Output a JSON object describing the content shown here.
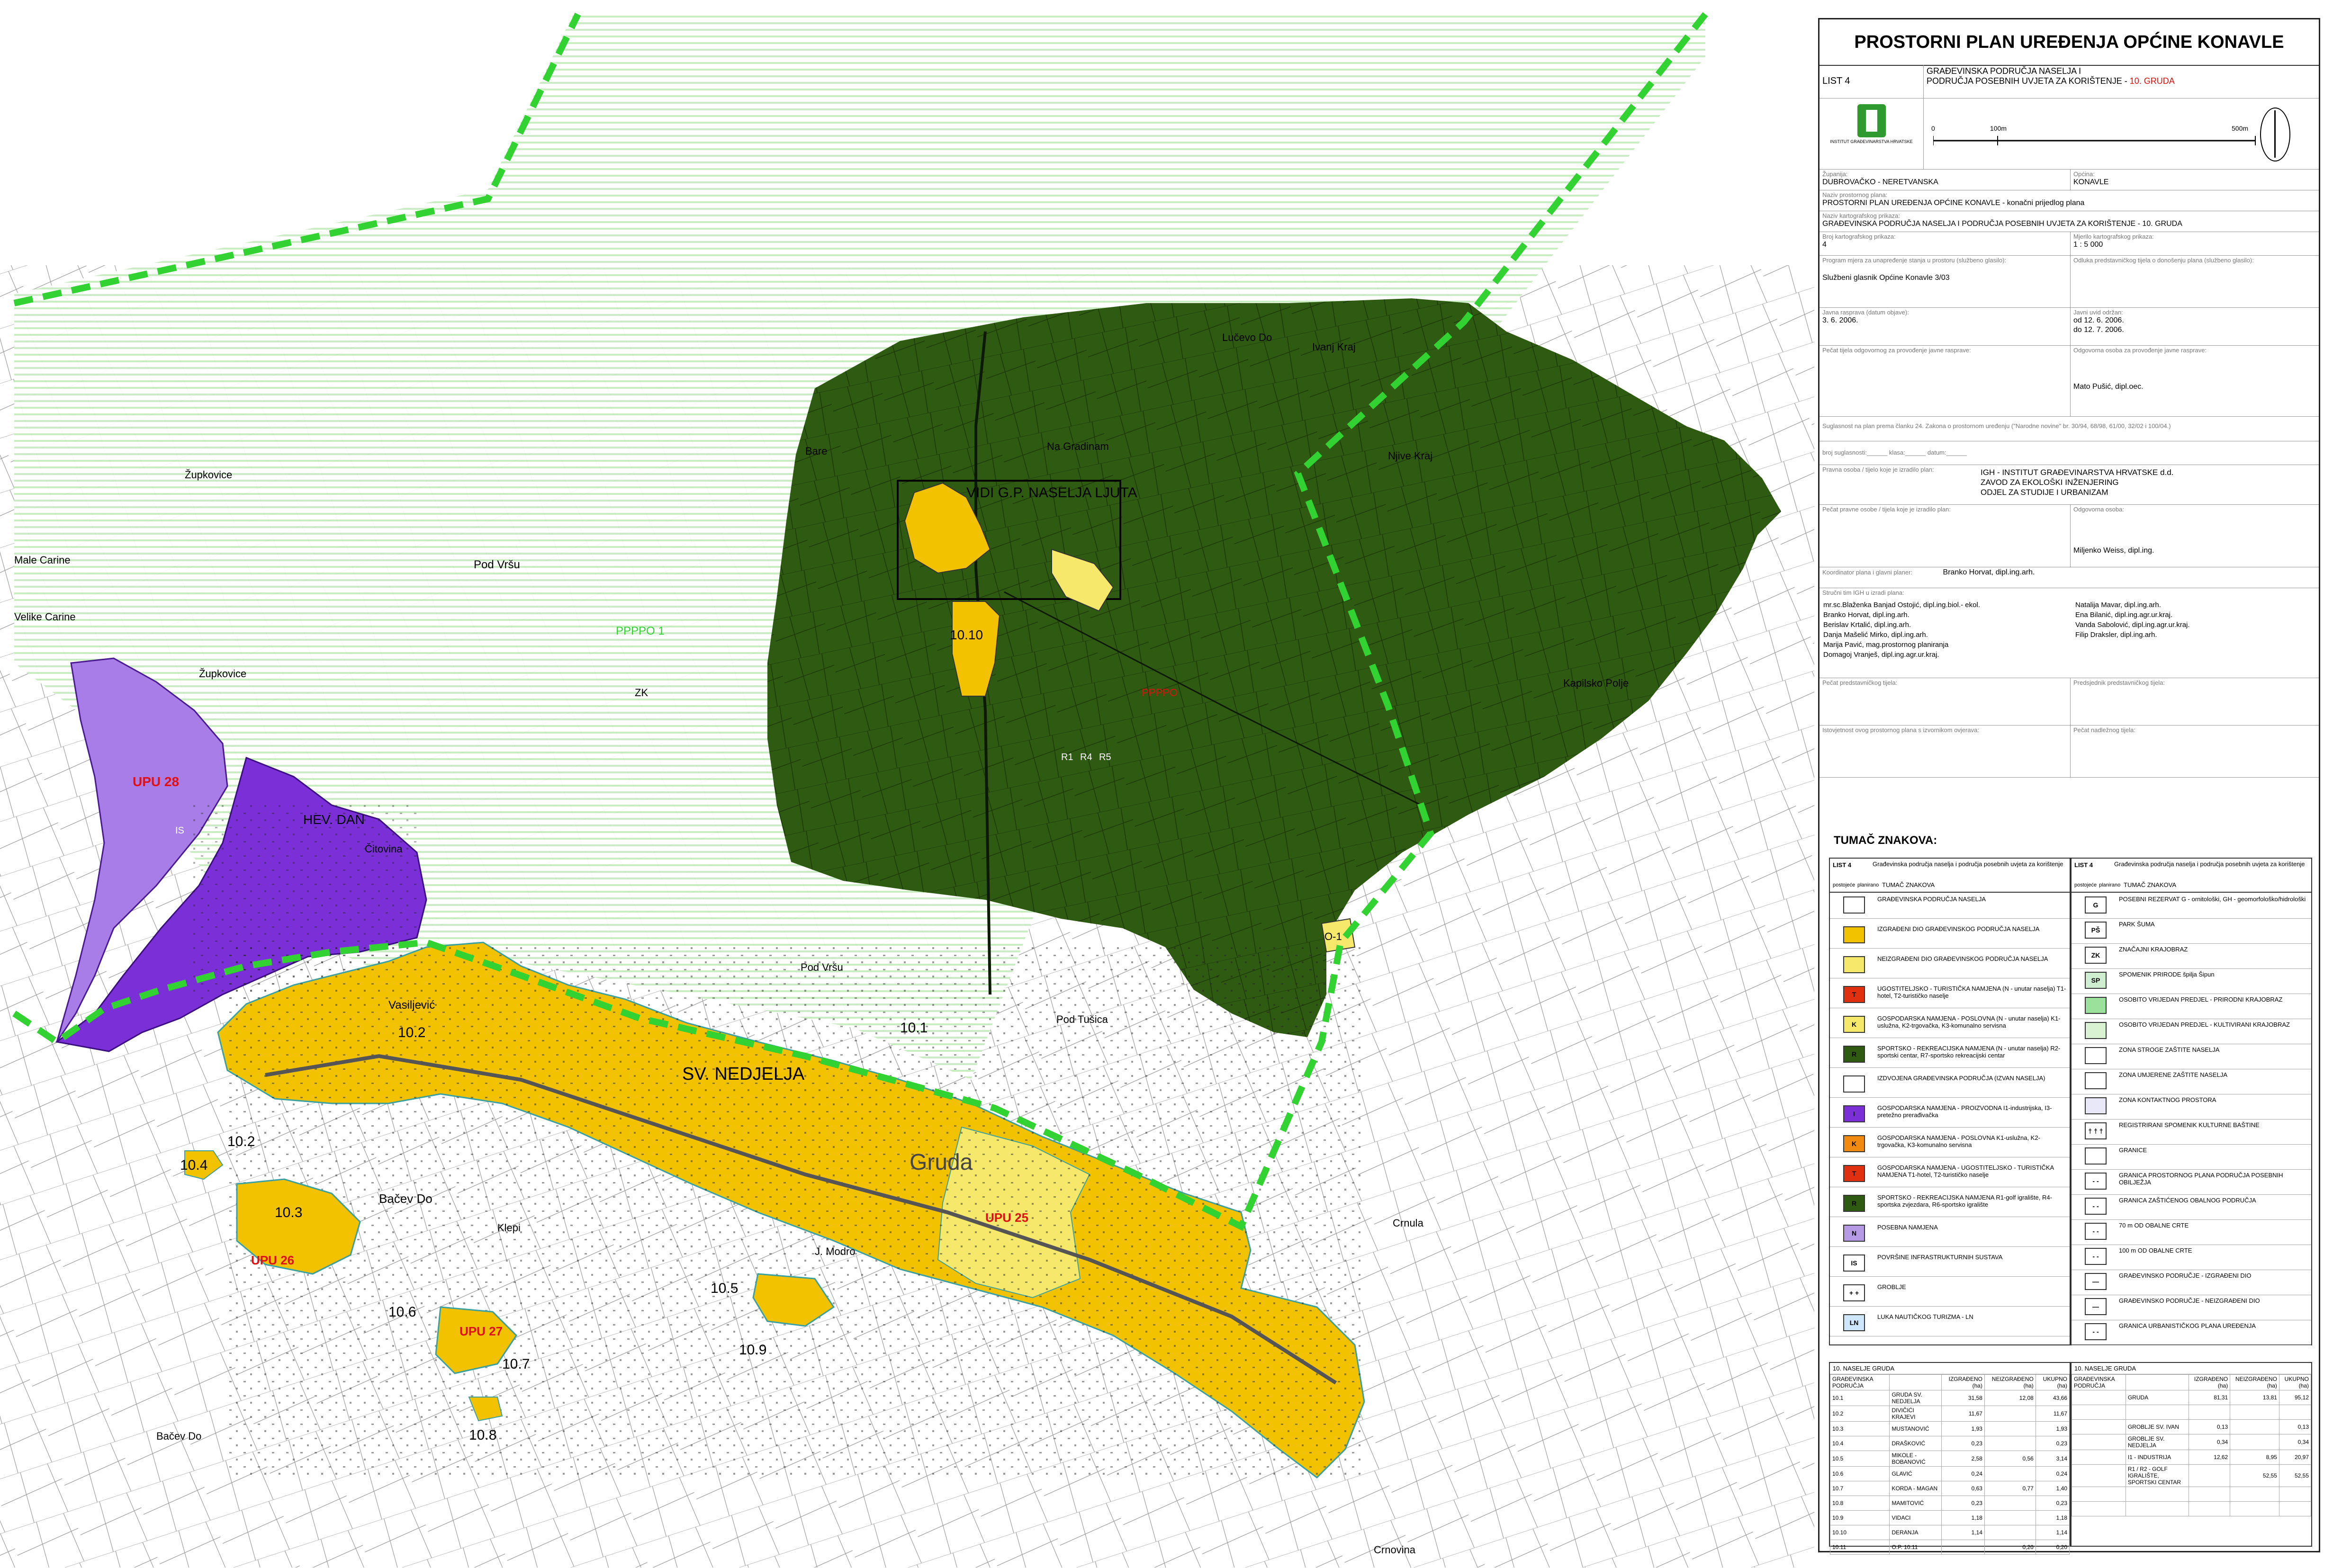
{
  "colors": {
    "forest": "#2f5a12",
    "built": "#f2c200",
    "unbuilt": "#f5e86a",
    "economic_light": "#a97de8",
    "economic_dark": "#7b2fd6",
    "boundary": "#32d232",
    "hatch": "#c8ecc0",
    "red_label": "#e01010"
  },
  "map": {
    "labels": {
      "ljuta_box": "VIDI G.P. NASELJA LJUTA",
      "sv_nedjelja": "SV. NEDJELJA",
      "gruda": "Gruda",
      "upu28_top": "UPU 28",
      "upu26": "UPU 26",
      "upu27": "UPU 27",
      "upu25": "UPU 25",
      "hevrenjak": "HEV. DAN",
      "pod_vrsu": "Pod Vršu",
      "vasiljevic": "Vasiljević",
      "bacev_do": "Bačev Do",
      "na_gradinam": "Na Gradinam",
      "lucovo": "Lučevo Do",
      "ivanj_kraj": "Ivanj Kraj",
      "mali_carine": "Male Carine",
      "velike_carine": "Velike Carine",
      "zupkovica": "Župkovice",
      "zupkovica2": "Župkovice",
      "pod_vrsu2": "Pod Vršu",
      "pod_tusica": "Pod Tušica",
      "crnula": "Crnula",
      "citovina": "Čitovina",
      "klepi": "Klepi",
      "njive_kraj": "Njive Kraj",
      "kapilsko_polje": "Kapilsko Polje",
      "bare": "Bare",
      "bacev_do2": "Bačev Do",
      "j_modro": "J. Modro",
      "crnovina": "Crnovina",
      "forest_code": "PPPPO",
      "pppp": "PPPPO 1",
      "zk": "ZK",
      "is": "IS",
      "r1": "R1",
      "r4": "R4",
      "r5": "R5",
      "o1": "O-1",
      "n_10_1": "10.1",
      "n_10_2": "10.2",
      "n_10_2b": "10.2",
      "n_10_3": "10.3",
      "n_10_4": "10.4",
      "n_10_5": "10.5",
      "n_10_6": "10.6",
      "n_10_7": "10.7",
      "n_10_8": "10.8",
      "n_10_9": "10.9",
      "n_10_10": "10.10"
    }
  },
  "panel": {
    "title": "PROSTORNI PLAN UREĐENJA OPĆINE KONAVLE",
    "list": "LIST 4",
    "subtitle1": "GRAĐEVINSKA PODRUČJA NASELJA I",
    "subtitle2": "PODRUČJA POSEBNIH UVJETA ZA KORIŠTENJE - ",
    "subtitle_red": "10. GRUDA",
    "logo_text": "INSTITUT GRAĐEVINARSTVA HRVATSKE",
    "scale": {
      "s0": "0",
      "s1": "100m",
      "s2": "500m"
    },
    "fields": {
      "zupanija_l": "Županija:",
      "zupanija_v": "DUBROVAČKO - NERETVANSKA",
      "opcina_l": "Općina:",
      "opcina_v": "KONAVLE",
      "naziv_plana_l": "Naziv prostornog plana:",
      "naziv_plana_v": "PROSTORNI PLAN UREĐENJA OPĆINE KONAVLE - konačni prijedlog plana",
      "naziv_prikaza_l": "Naziv kartografskog prikaza:",
      "naziv_prikaza_v": "GRAĐEVINSKA PODRUČJA NASELJA I PODRUČJA POSEBNIH UVJETA ZA KORIŠTENJE - 10. GRUDA",
      "broj_l": "Broj kartografskog prikaza:",
      "broj_v": "4",
      "mjerilo_l": "Mjerilo kartografskog prikaza:",
      "mjerilo_v": "1 : 5 000",
      "program_l": "Program mjera za unapređenje stanja u prostoru (službeno glasilo):",
      "program_v": "Službeni glasnik Općine Konavle 3/03",
      "odluka_l": "Odluka predstavničkog tijela o donošenju plana (službeno glasilo):",
      "odluka_v": "",
      "javna_l": "Javna rasprava (datum objave):",
      "javna_v": "3. 6. 2006.",
      "javni_uvid_l": "Javni uvid održan:",
      "javni_uvid_v1": "od 12. 6. 2006.",
      "javni_uvid_v2": "do 12. 7. 2006.",
      "pecat_l": "Pečat tijela odgovornog za provođenje javne rasprave:",
      "odgovorna_l": "Odgovorna osoba za provođenje javne rasprave:",
      "odgovorna_v": "Mato Pušić, dipl.oec.",
      "suglasnost": "Suglasnost na plan prema članku   24.  Zakona o prostornom uređenju  (\"Narodne novine\"  br. 30/94, 68/98, 61/00, 32/02 i 100/04.)",
      "klasa": "broj suglasnosti:______ klasa:______ datum:______",
      "pravna_l": "Pravna osoba / tijelo koje je izradilo plan:",
      "pravna_v1": "IGH - INSTITUT GRAĐEVINARSTVA HRVATSKE d.d.",
      "pravna_v2": "ZAVOD ZA EKOLOŠKI INŽENJERING",
      "pravna_v3": "ODJEL ZA STUDIJE I URBANIZAM",
      "pecat_pravne_l": "Pečat pravne osobe / tijela koje je izradilo plan:",
      "odgovorna_osoba_l": "Odgovorna osoba:",
      "odgovorna_osoba_v": "Miljenko Weiss, dipl.ing.",
      "koordinator_l": "Koordinator plana i glavni planer:",
      "koordinator_v": "Branko Horvat, dipl.ing.arh.",
      "strucni_l": "Stručni tim IGH u izradi plana:",
      "tim_left": [
        "mr.sc.Blaženka Banjad Ostojić, dipl.ing.biol.- ekol.",
        "Branko Horvat, dipl.ing.arh.",
        "Berislav Krtalić, dipl.ing.arh.",
        "Danja Mašelić Mirko, dipl.ing.arh.",
        "Marija Pavić, mag.prostornog planiranja",
        "Domagoj Vranješ, dipl.ing.agr.ur.kraj."
      ],
      "tim_right": [
        "Natalija Mavar, dipl.ing.arh.",
        "Ena Bilanić, dipl.ing.agr.ur.kraj.",
        "Vanda Sabolović, dipl.ing.agr.ur.kraj.",
        "Filip Draksler, dipl.ing.arh."
      ],
      "pecat_pred_l": "Pečat predstavničkog tijela:",
      "predsjednik_l": "Predsjednik predstavničkog tijela:",
      "istovjetnost_l": "Istovjetnost ovog prostornog plana s izvornikom ovjerava:",
      "pecat_nadl_l": "Pečat nadležnog tijela:"
    },
    "legend_title": "TUMAČ ZNAKOVA:",
    "legend_left_head": {
      "list": "LIST 4",
      "text": "Građevinska područja naselja i područja posebnih uvjeta za korištenje",
      "c1": "postojeće",
      "c2": "planirano",
      "c3": "TUMAČ ZNAKOVA"
    },
    "legend_left": [
      {
        "sym": "",
        "color": "#ffffff",
        "label": "GRAĐEVINSKA PODRUČJA NASELJA"
      },
      {
        "sym": "",
        "color": "#f2c200",
        "label": "IZGRAĐENI DIO GRAĐEVINSKOG PODRUČJA NASELJA"
      },
      {
        "sym": "",
        "color": "#f5e86a",
        "label": "NEIZGRAĐENI DIO GRAĐEVINSKOG PODRUČJA NASELJA"
      },
      {
        "sym": "T",
        "color": "#e03010",
        "label": "UGOSTITELJSKO - TURISTIČKA NAMJENA (N - unutar naselja) T1-hotel, T2-turističko naselje"
      },
      {
        "sym": "K",
        "color": "#f5e86a",
        "label": "GOSPODARSKA NAMJENA - POSLOVNA (N - unutar naselja) K1-uslužna, K2-trgovačka, K3-komunalno servisna"
      },
      {
        "sym": "R",
        "color": "#2f5a12",
        "label": "SPORTSKO - REKREACIJSKA NAMJENA (N - unutar naselja) R2-sportski centar, R7-sportsko rekreacijski centar"
      },
      {
        "sym": "",
        "color": "#ffffff",
        "label": "IZDVOJENA GRAĐEVINSKA PODRUČJA (IZVAN NASELJA)"
      },
      {
        "sym": "I",
        "color": "#7b2fd6",
        "label": "GOSPODARSKA NAMJENA - PROIZVODNA I1-industrijska, I3-pretežno prerađivačka"
      },
      {
        "sym": "K",
        "color": "#f08a10",
        "label": "GOSPODARSKA NAMJENA - POSLOVNA K1-uslužna, K2-trgovačka, K3-komunalno servisna"
      },
      {
        "sym": "T",
        "color": "#e03010",
        "label": "GOSPODARSKA NAMJENA - UGOSTITELJSKO - TURISTIČKA NAMJENA T1-hotel, T2-turističko naselje"
      },
      {
        "sym": "R",
        "color": "#2f5a12",
        "label": "SPORTSKO - REKREACIJSKA NAMJENA R1-golf igralište, R4-sportska zvjezdara, R6-sportsko igralište"
      },
      {
        "sym": "N",
        "color": "#b79ae6",
        "label": "POSEBNA NAMJENA"
      },
      {
        "sym": "IS",
        "color": "#ffffff",
        "label": "POVRŠINE INFRASTRUKTURNIH SUSTAVA"
      },
      {
        "sym": "+ +",
        "color": "#ffffff",
        "label": "GROBLJE"
      },
      {
        "sym": "LN",
        "color": "#cfe6ff",
        "label": "LUKA NAUTIČKOG TURIZMA - LN"
      }
    ],
    "legend_right_head": {
      "list": "LIST 4",
      "text": "Građevinska područja naselja i područja posebnih uvjeta za korištenje",
      "c1": "postojeće",
      "c2": "planirano",
      "c3": "TUMAČ ZNAKOVA"
    },
    "legend_right": [
      {
        "sym": "G",
        "color": "#ffffff",
        "label": "POSEBNI REZERVAT G - ornitološki, GH - geomorfološko/hidrološki"
      },
      {
        "sym": "PŠ",
        "color": "#ffffff",
        "label": "PARK ŠUMA"
      },
      {
        "sym": "ZK",
        "color": "#ffffff",
        "label": "ZNAČAJNI KRAJOBRAZ"
      },
      {
        "sym": "SP",
        "color": "#cfeecf",
        "label": "SPOMENIK PRIRODE špilja Šipun"
      },
      {
        "sym": "",
        "color": "#9be09b",
        "label": "OSOBITO VRIJEDAN PREDJEL - PRIRODNI KRAJOBRAZ"
      },
      {
        "sym": "",
        "color": "#d9f2d2",
        "label": "OSOBITO VRIJEDAN PREDJEL - KULTIVIRANI KRAJOBRAZ"
      },
      {
        "sym": "",
        "color": "#ffffff",
        "label": "ZONA STROGE ZAŠTITE NASELJA"
      },
      {
        "sym": "",
        "color": "#ffffff",
        "label": "ZONA UMJERENE ZAŠTITE NASELJA"
      },
      {
        "sym": "",
        "color": "#e8e8f8",
        "label": "ZONA KONTAKTNOG PROSTORA"
      },
      {
        "sym": "† † †",
        "color": "#ffffff",
        "label": "REGISTRIRANI SPOMENIK KULTURNE BAŠTINE"
      },
      {
        "sym": "",
        "color": "#ffffff",
        "label": "GRANICE"
      },
      {
        "sym": "- -",
        "color": "#ffffff",
        "label": "GRANICA PROSTORNOG PLANA PODRUČJA POSEBNIH OBILJEŽJA"
      },
      {
        "sym": "- -",
        "color": "#ffffff",
        "label": "GRANICA ZAŠTIĆENOG OBALNOG PODRUČJA"
      },
      {
        "sym": "- -",
        "color": "#ffffff",
        "label": "70 m OD OBALNE CRTE"
      },
      {
        "sym": "- -",
        "color": "#ffffff",
        "label": "100 m OD OBALNE CRTE"
      },
      {
        "sym": "—",
        "color": "#ffffff",
        "label": "GRAĐEVINSKO PODRUČJE - IZGRAĐENI DIO"
      },
      {
        "sym": "—",
        "color": "#ffffff",
        "label": "GRAĐEVINSKO PODRUČJE - NEIZGRAĐENI DIO"
      },
      {
        "sym": "- -",
        "color": "#ffffff",
        "label": "GRANICA URBANISTIČKOG PLANA UREĐENJA"
      }
    ],
    "table_left": {
      "title": "10. NASELJE GRUDA",
      "head": [
        "GRAĐEVINSKA PODRUČJA",
        "",
        "IZGRAĐENO (ha)",
        "NEIZGRAĐENO (ha)",
        "UKUPNO (ha)"
      ],
      "rows": [
        [
          "10.1",
          "GRUDA SV. NEDJELJA",
          "31,58",
          "12,08",
          "43,66"
        ],
        [
          "10.2",
          "DIVIČIĆI KRAJEVI",
          "11,67",
          "",
          "11,67"
        ],
        [
          "10.3",
          "MUSTANOVIĆ",
          "1,93",
          "",
          "1,93"
        ],
        [
          "10.4",
          "DRAŠKOVIĆ",
          "0,23",
          "",
          "0,23"
        ],
        [
          "10.5",
          "MIKOLE - BOBANOVIĆ",
          "2,58",
          "0,56",
          "3,14"
        ],
        [
          "10.6",
          "GLAVIĆ",
          "0,24",
          "",
          "0,24"
        ],
        [
          "10.7",
          "KORDA - MAGAN",
          "0,63",
          "0,77",
          "1,40"
        ],
        [
          "10.8",
          "MAMITOVIĆ",
          "0,23",
          "",
          "0,23"
        ],
        [
          "10.9",
          "VIDACI",
          "1,18",
          "",
          "1,18"
        ],
        [
          "10.10",
          "DERANJA",
          "1,14",
          "",
          "1,14"
        ],
        [
          "10.11",
          "O.P. 10.11",
          "",
          "0,20",
          "0,20"
        ]
      ]
    },
    "table_right": {
      "title": "10. NASELJE GRUDA",
      "head": [
        "GRAĐEVINSKA PODRUČJA",
        "",
        "IZGRAĐENO (ha)",
        "NEIZGRAĐENO (ha)",
        "UKUPNO (ha)"
      ],
      "rows": [
        [
          "",
          "GRUDA",
          "81,31",
          "13,81",
          "95,12"
        ],
        [
          "",
          "",
          "",
          "",
          ""
        ],
        [
          "",
          "GROBLJE SV. IVAN",
          "0,13",
          "",
          "0,13"
        ],
        [
          "",
          "GROBLJE SV. NEDJELJA",
          "0,34",
          "",
          "0,34"
        ],
        [
          "",
          "I1 - INDUSTRIJA",
          "12,62",
          "8,95",
          "20,97"
        ],
        [
          "",
          "R1 / R2 - GOLF IGRALIŠTE, SPORTSKI CENTAR",
          "",
          "52,55",
          "52,55"
        ],
        [
          "",
          "",
          "",
          "",
          ""
        ],
        [
          "",
          "",
          "",
          "",
          ""
        ]
      ]
    }
  }
}
